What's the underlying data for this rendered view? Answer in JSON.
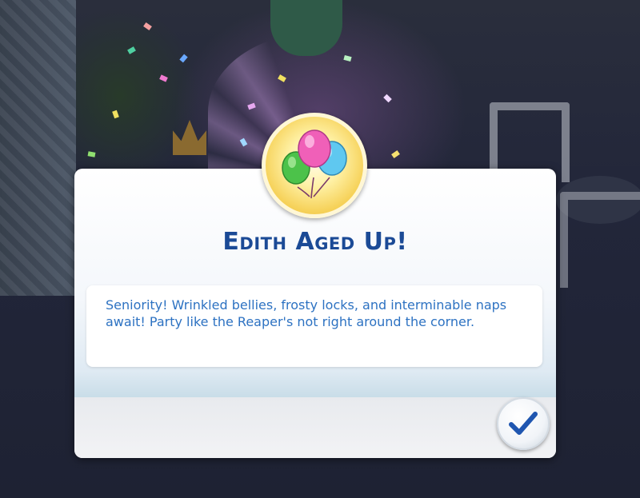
{
  "dialog": {
    "title": "Edith Aged Up!",
    "message": "Seniority! Wrinkled bellies, frosty locks, and interminable naps await! Party like the Reaper's not right around the corner.",
    "confirm_icon": "checkmark-icon",
    "badge_icon": "balloons-icon"
  },
  "colors": {
    "title": "#1b4a96",
    "message_text": "#2d72c2",
    "check": "#1f56b0",
    "badge_gold": "#f6d25a"
  }
}
